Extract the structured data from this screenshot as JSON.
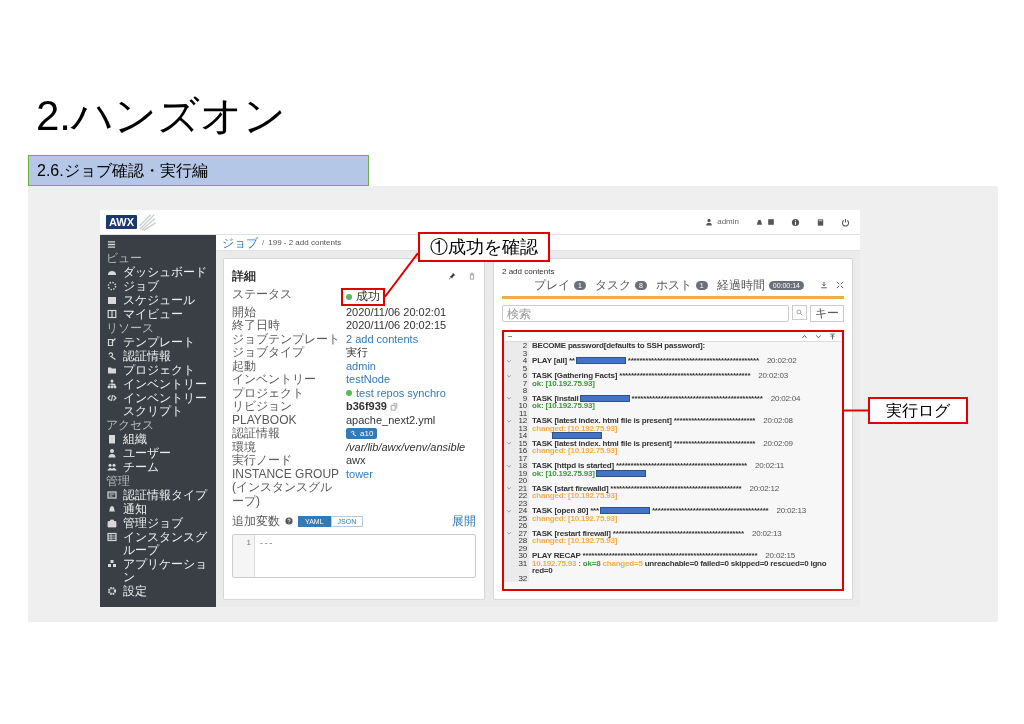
{
  "slide": {
    "title": "2.ハンズオン",
    "subtitle": "2.6.ジョブ確認・実行編"
  },
  "callouts": [
    {
      "text": "①成功を確認"
    },
    {
      "text": "実行ログ"
    }
  ],
  "topbar": {
    "logo": "AWX",
    "user": "admin"
  },
  "sidebar": {
    "sections": [
      {
        "heading": "ビュー",
        "items": [
          "ダッシュボード",
          "ジョブ",
          "スケジュール",
          "マイビュー"
        ]
      },
      {
        "heading": "リソース",
        "items": [
          "テンプレート",
          "認証情報",
          "プロジェクト",
          "インベントリー",
          "インベントリースクリプト"
        ]
      },
      {
        "heading": "アクセス",
        "items": [
          "組織",
          "ユーザー",
          "チーム"
        ]
      },
      {
        "heading": "管理",
        "items": [
          "認証情報タイプ",
          "通知",
          "管理ジョブ",
          "インスタンスグループ",
          "アプリケーション",
          "設定"
        ]
      }
    ]
  },
  "breadcrumb": {
    "items": [
      "ジョブ",
      "199 - 2 add contents"
    ],
    "separator": "/"
  },
  "details": {
    "title": "詳細",
    "fields": [
      {
        "label": "ステータス",
        "value": "成功",
        "kind": "status"
      },
      {
        "label": "開始",
        "value": "2020/11/06 20:02:01",
        "kind": "text"
      },
      {
        "label": "終了日時",
        "value": "2020/11/06 20:02:15",
        "kind": "text"
      },
      {
        "label": "ジョブテンプレート",
        "value": "2 add contents",
        "kind": "link"
      },
      {
        "label": "ジョブタイプ",
        "value": "実行",
        "kind": "text"
      },
      {
        "label": "起動",
        "value": "admin",
        "kind": "link"
      },
      {
        "label": "インベントリー",
        "value": "testNode",
        "kind": "link"
      },
      {
        "label": "プロジェクト",
        "value": "test repos synchro",
        "kind": "link_status"
      },
      {
        "label": "リビジョン",
        "value": "b36f939",
        "kind": "copy"
      },
      {
        "label": "PLAYBOOK",
        "value": "apache_next2.yml",
        "kind": "text"
      },
      {
        "label": "認証情報",
        "value": "a10",
        "kind": "credential"
      },
      {
        "label": "環境",
        "value": "/var/lib/awx/venv/ansible",
        "kind": "path"
      },
      {
        "label": "実行ノード",
        "value": "awx",
        "kind": "text"
      },
      {
        "label": "INSTANCE GROUP (インスタンスグループ)",
        "value": "tower",
        "kind": "link"
      }
    ],
    "extra_vars": {
      "label": "追加変数",
      "modes": [
        {
          "label": "YAML",
          "selected": true
        },
        {
          "label": "JSON",
          "selected": false
        }
      ],
      "expand": "展開",
      "editor": [
        {
          "number": "1",
          "text": "---"
        }
      ]
    }
  },
  "output": {
    "title": "2 add contents",
    "counts": [
      {
        "label": "プレイ",
        "value": "1"
      },
      {
        "label": "タスク",
        "value": "8"
      },
      {
        "label": "ホスト",
        "value": "1"
      },
      {
        "label": "経過時間",
        "value": "00:00:14"
      }
    ],
    "progress": {
      "level": 1
    },
    "search": {
      "placeholder": "検索"
    },
    "key_button": "キー",
    "collapse": "−",
    "lines": [
      {
        "number": "2",
        "parts": [
          {
            "kind": "text",
            "text": "BECOME password[defaults to SSH password]:",
            "color": "#333333"
          }
        ]
      },
      {
        "number": "3"
      },
      {
        "number": "4",
        "expandable": true,
        "parts": [
          {
            "kind": "text",
            "text": "PLAY [all] **",
            "color": "#333333"
          },
          {
            "kind": "redaction"
          },
          {
            "kind": "text",
            "text": "*********************************************",
            "color": "#333333"
          }
        ],
        "time": "20:02:02"
      },
      {
        "number": "5"
      },
      {
        "number": "6",
        "expandable": true,
        "parts": [
          {
            "kind": "text",
            "text": "TASK [Gathering Facts] *********************************************",
            "color": "#333333"
          }
        ],
        "time": "20:02:03"
      },
      {
        "number": "7",
        "parts": [
          {
            "kind": "text",
            "text": "ok: [10.192.75.93]",
            "color": "#3c9a3c"
          }
        ]
      },
      {
        "number": "8"
      },
      {
        "number": "9",
        "expandable": true,
        "parts": [
          {
            "kind": "text",
            "text": "TASK [install",
            "color": "#333333"
          },
          {
            "kind": "redaction"
          },
          {
            "kind": "text",
            "text": "*********************************************",
            "color": "#333333"
          }
        ],
        "time": "20:02:04"
      },
      {
        "number": "10",
        "parts": [
          {
            "kind": "text",
            "text": "ok: [10.192.75.93]",
            "color": "#3c9a3c"
          }
        ]
      },
      {
        "number": "11"
      },
      {
        "number": "12",
        "expandable": true,
        "parts": [
          {
            "kind": "text",
            "text": "TASK [latest index. html file is present] ****************************",
            "color": "#333333"
          }
        ],
        "time": "20:02:08"
      },
      {
        "number": "13",
        "parts": [
          {
            "kind": "text",
            "text": "changed: [10.192.75.93]",
            "color": "#f0ad4e"
          }
        ]
      },
      {
        "number": "14",
        "parts": [
          {
            "kind": "redaction"
          }
        ]
      },
      {
        "number": "15",
        "expandable": true,
        "parts": [
          {
            "kind": "text",
            "text": "TASK [latest index. html file is present] ****************************",
            "color": "#333333"
          }
        ],
        "time": "20:02:09"
      },
      {
        "number": "16",
        "parts": [
          {
            "kind": "text",
            "text": "changed: [10.192.75.93]",
            "color": "#f0ad4e"
          }
        ]
      },
      {
        "number": "17"
      },
      {
        "number": "18",
        "expandable": true,
        "parts": [
          {
            "kind": "text",
            "text": "TASK [httpd is started] *********************************************",
            "color": "#333333"
          }
        ],
        "time": "20:02:11"
      },
      {
        "number": "19",
        "parts": [
          {
            "kind": "text",
            "text": "ok: [10.192.75.93]",
            "color": "#3c9a3c"
          },
          {
            "kind": "redaction"
          }
        ]
      },
      {
        "number": "20"
      },
      {
        "number": "21",
        "expandable": true,
        "parts": [
          {
            "kind": "text",
            "text": "TASK [start firewalld] *********************************************",
            "color": "#333333"
          }
        ],
        "time": "20:02:12"
      },
      {
        "number": "22",
        "parts": [
          {
            "kind": "text",
            "text": "changed: [10.192.75.93]",
            "color": "#f0ad4e"
          }
        ]
      },
      {
        "number": "23"
      },
      {
        "number": "24",
        "expandable": true,
        "parts": [
          {
            "kind": "text",
            "text": "TASK [open 80] ***",
            "color": "#333333"
          },
          {
            "kind": "redaction"
          },
          {
            "kind": "text",
            "text": "****************************************",
            "color": "#333333"
          }
        ],
        "time": "20:02:13"
      },
      {
        "number": "25",
        "parts": [
          {
            "kind": "text",
            "text": "changed: [10.192.75.93]",
            "color": "#f0ad4e"
          }
        ]
      },
      {
        "number": "26"
      },
      {
        "number": "27",
        "expandable": true,
        "parts": [
          {
            "kind": "text",
            "text": "TASK [restart firewall] *********************************************",
            "color": "#333333"
          }
        ],
        "time": "20:02:13"
      },
      {
        "number": "28",
        "parts": [
          {
            "kind": "text",
            "text": "changed: [10.192.75.93]",
            "color": "#f0ad4e"
          }
        ]
      },
      {
        "number": "29"
      },
      {
        "number": "30",
        "parts": [
          {
            "kind": "text",
            "text": "PLAY RECAP ************************************************************",
            "color": "#333333"
          }
        ],
        "time": "20:02:15"
      },
      {
        "number": "31",
        "parts": [
          {
            "kind": "text",
            "text": "10.192.75.93",
            "color": "#f0ad4e"
          },
          {
            "kind": "text",
            "text": ": ok=8",
            "color": "#3c9a3c"
          },
          {
            "kind": "text",
            "text": "changed=5",
            "color": "#f0ad4e"
          },
          {
            "kind": "text",
            "text": "unreachable=0 failed=0 skipped=0 rescued=0 igno",
            "color": "#333333"
          },
          {
            "kind": "wrapped",
            "text": "red=0",
            "color": "#333333"
          }
        ]
      },
      {
        "number": "32"
      }
    ]
  }
}
